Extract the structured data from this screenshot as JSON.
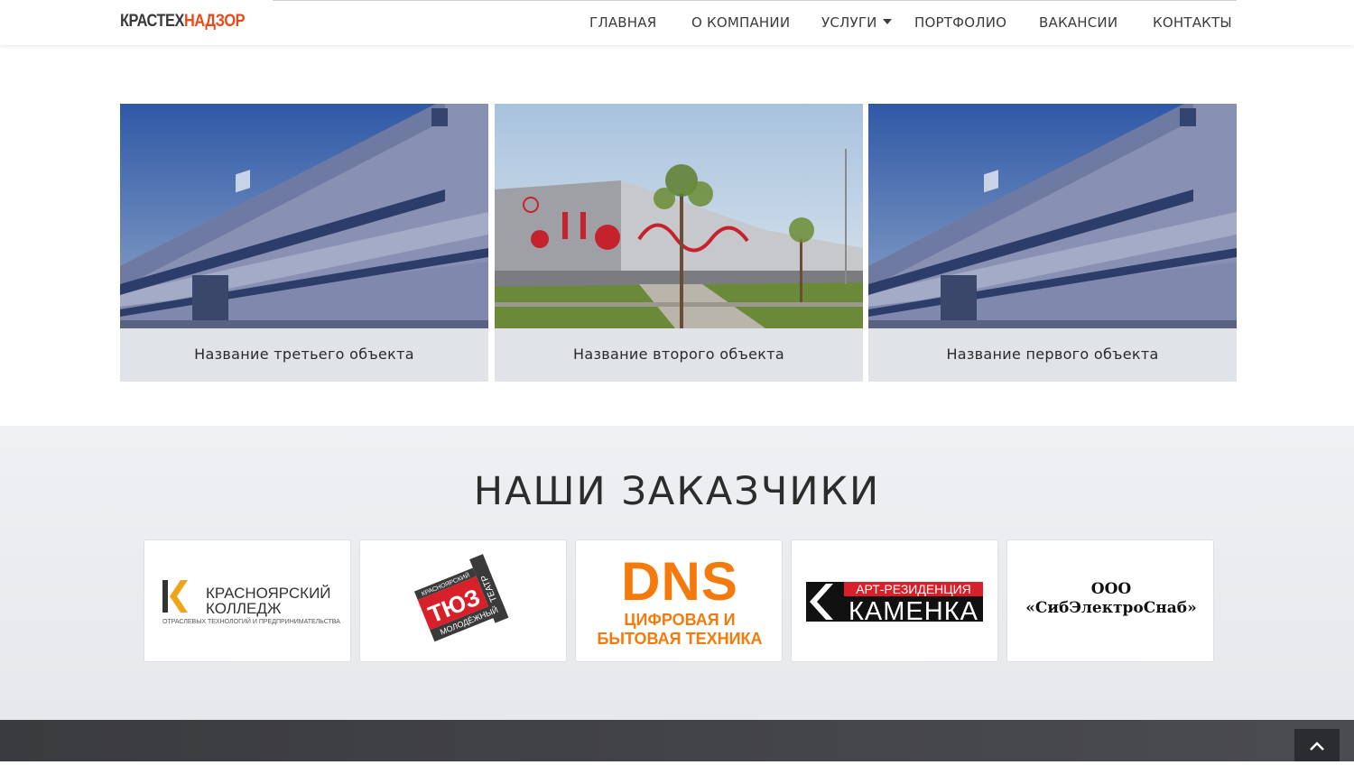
{
  "header": {
    "logo_part1": "КРАСТЕХ",
    "logo_part2": "НАДЗОР",
    "nav": [
      {
        "label": "ГЛАВНАЯ"
      },
      {
        "label": "О КОМПАНИИ"
      },
      {
        "label": "УСЛУГИ"
      },
      {
        "label": "ПОРТФОЛИО"
      },
      {
        "label": "ВАКАНСИИ"
      },
      {
        "label": "КОНТАКТЫ"
      }
    ]
  },
  "portfolio": {
    "items": [
      {
        "title": "Название третьего объекта"
      },
      {
        "title": "Название второго объекта"
      },
      {
        "title": "Название первого объекта"
      }
    ]
  },
  "clients": {
    "heading": "НАШИ ЗАКАЗЧИКИ",
    "logos": [
      {
        "line1": "КРАСНОЯРСКИЙ",
        "line2": "КОЛЛЕДЖ",
        "line3": "ОТРАСЛЕВЫХ ТЕХНОЛОГИЙ И ПРЕДПРИНИМАТЕЛЬСТВА"
      },
      {
        "small_top": "КРАСНОЯРСКИЙ",
        "main": "ТЮЗ",
        "side": "ТЕАТР",
        "bottom": "МОЛОДЁЖНЫЙ"
      },
      {
        "brand": "DNS",
        "line1": "ЦИФРОВАЯ И",
        "line2": "БЫТОВАЯ ТЕХНИКА"
      },
      {
        "top": "АРТ-РЕЗИДЕНЦИЯ",
        "name": "КАМЕНКА"
      },
      {
        "line1": "ООО",
        "line2": "«СибЭлектроСнаб»"
      }
    ]
  },
  "colors": {
    "accent": "#ea4a1b",
    "dns_orange": "#f47b0b",
    "footer": "#3d3e41"
  }
}
